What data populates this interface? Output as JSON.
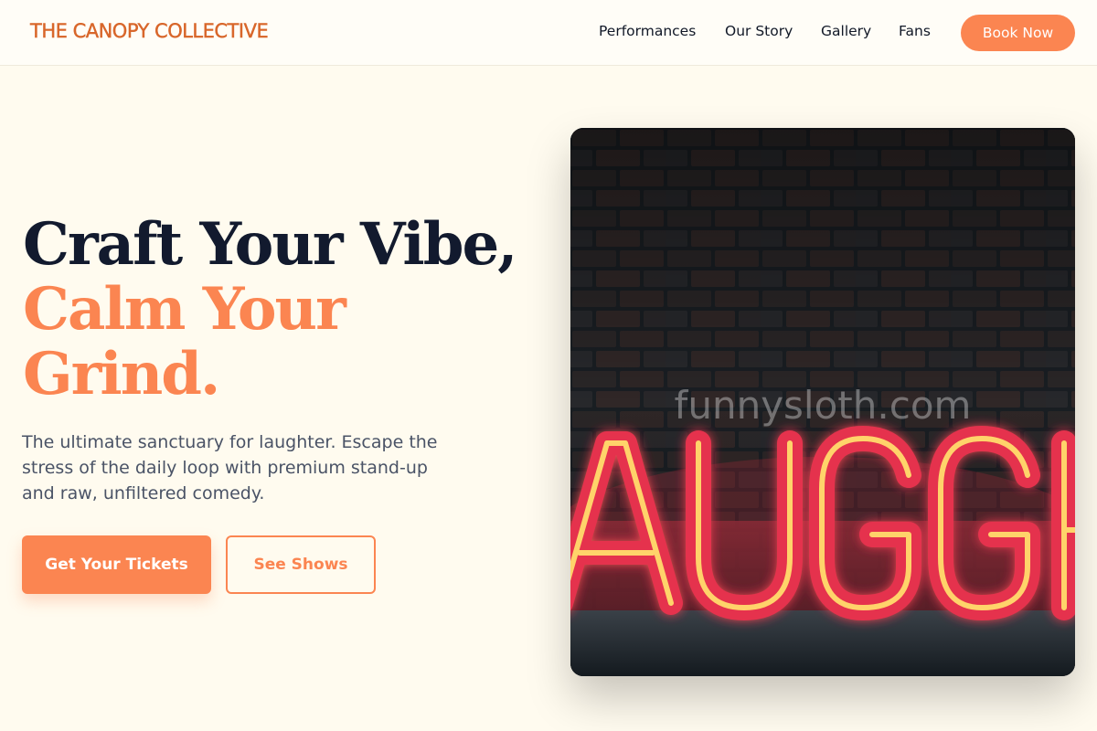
{
  "header": {
    "brand": "THE CANOPY COLLECTIVE",
    "nav": [
      {
        "label": "Performances"
      },
      {
        "label": "Our Story"
      },
      {
        "label": "Gallery"
      },
      {
        "label": "Fans"
      }
    ],
    "cta_label": "Book Now"
  },
  "hero": {
    "title_line1": "Craft Your Vibe,",
    "title_line2": "Calm Your",
    "title_line3": "Grind.",
    "subtitle": "The ultimate sanctuary for laughter. Escape the stress of the daily loop with premium stand-up and raw, unfiltered comedy.",
    "primary_button": "Get Your Tickets",
    "secondary_button": "See Shows",
    "image": {
      "watermark": "funnysloth.com",
      "sign_text": "AUGH",
      "subject": "neon-sign-laugh"
    }
  },
  "colors": {
    "accent": "#fb8551",
    "brand": "#d8662a",
    "background": "#fffbef",
    "heading": "#121a2e",
    "body_text": "#4a5366"
  }
}
